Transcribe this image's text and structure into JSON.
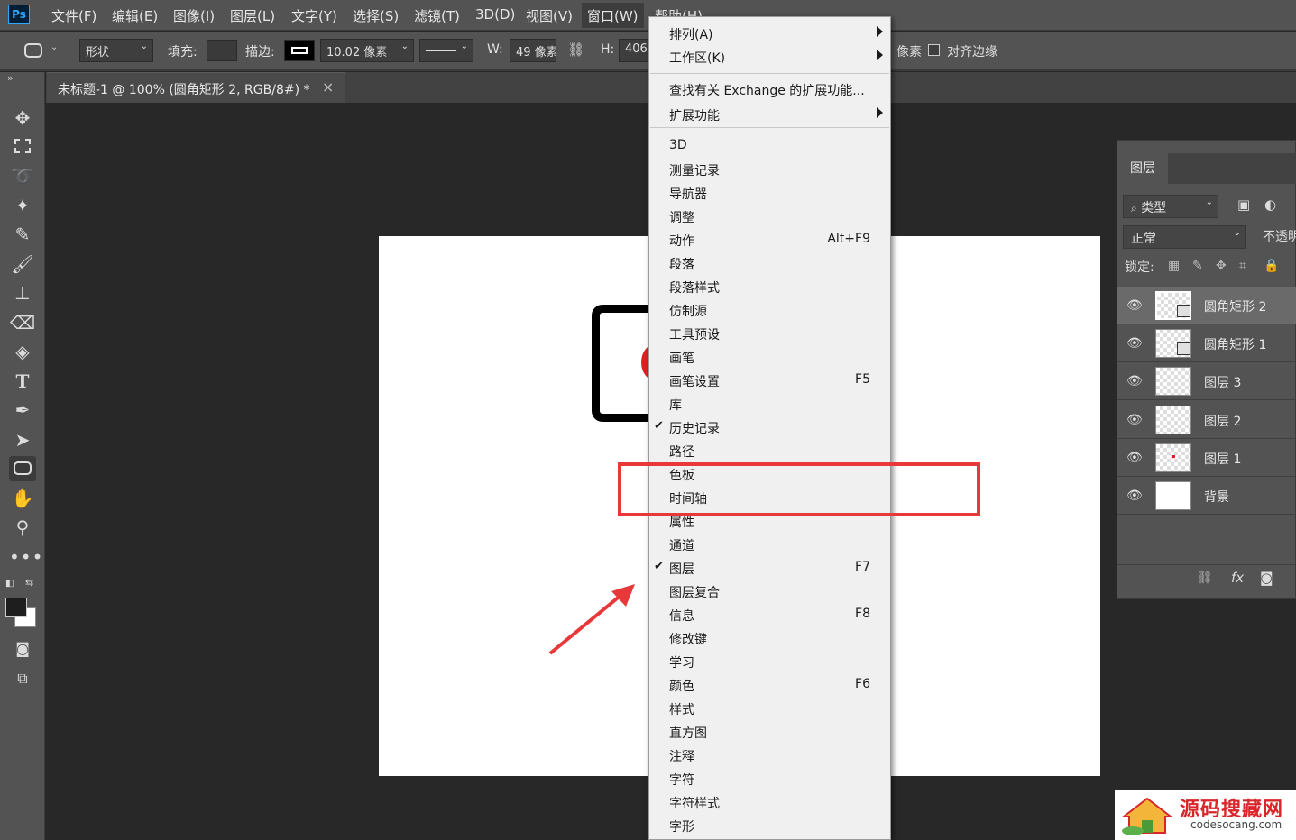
{
  "app": {
    "logo": "Ps"
  },
  "menubar": {
    "items": [
      "文件(F)",
      "编辑(E)",
      "图像(I)",
      "图层(L)",
      "文字(Y)",
      "选择(S)",
      "滤镜(T)",
      "3D(D)",
      "视图(V)",
      "窗口(W)",
      "帮助(H)"
    ]
  },
  "options": {
    "shape_mode": "形状",
    "fill_label": "填充:",
    "stroke_label": "描边:",
    "stroke_width": "10.02 像素",
    "w_label": "W:",
    "w_value": "49 像素",
    "h_label": "H:",
    "h_value": "406",
    "px_unit": "像素",
    "align_edges": "对齐边缘"
  },
  "document": {
    "tab_title": "未标题-1 @ 100% (圆角矩形 2, RGB/8#) *",
    "close": "×"
  },
  "window_menu": {
    "items": [
      {
        "label": "排列(A)",
        "submenu": true
      },
      {
        "label": "工作区(K)",
        "submenu": true
      },
      {
        "label": "查找有关 Exchange 的扩展功能..."
      },
      {
        "label": "扩展功能",
        "submenu": true
      },
      {
        "label": "3D"
      },
      {
        "label": "测量记录"
      },
      {
        "label": "导航器"
      },
      {
        "label": "调整"
      },
      {
        "label": "动作",
        "shortcut": "Alt+F9"
      },
      {
        "label": "段落"
      },
      {
        "label": "段落样式"
      },
      {
        "label": "仿制源"
      },
      {
        "label": "工具预设"
      },
      {
        "label": "画笔"
      },
      {
        "label": "画笔设置",
        "shortcut": "F5"
      },
      {
        "label": "库"
      },
      {
        "label": "历史记录",
        "checked": true
      },
      {
        "label": "路径"
      },
      {
        "label": "色板"
      },
      {
        "label": "时间轴"
      },
      {
        "label": "属性"
      },
      {
        "label": "通道"
      },
      {
        "label": "图层",
        "shortcut": "F7",
        "checked": true
      },
      {
        "label": "图层复合"
      },
      {
        "label": "信息",
        "shortcut": "F8"
      },
      {
        "label": "修改键"
      },
      {
        "label": "学习"
      },
      {
        "label": "颜色",
        "shortcut": "F6"
      },
      {
        "label": "样式"
      },
      {
        "label": "直方图"
      },
      {
        "label": "注释"
      },
      {
        "label": "字符"
      },
      {
        "label": "字符样式"
      },
      {
        "label": "字形"
      }
    ],
    "check_mark": "✔"
  },
  "layers_panel": {
    "tab": "图层",
    "filter_kind": "类型",
    "blend_mode": "正常",
    "opacity_label": "不透明",
    "lock_label": "锁定:",
    "fx_label": "fx",
    "layers": [
      {
        "name": "圆角矩形 2",
        "selected": true
      },
      {
        "name": "圆角矩形 1"
      },
      {
        "name": "图层 3"
      },
      {
        "name": "图层 2"
      },
      {
        "name": "图层 1"
      },
      {
        "name": "背景"
      }
    ]
  },
  "watermark": {
    "title": "源码搜藏网",
    "url": "codesocang.com"
  }
}
